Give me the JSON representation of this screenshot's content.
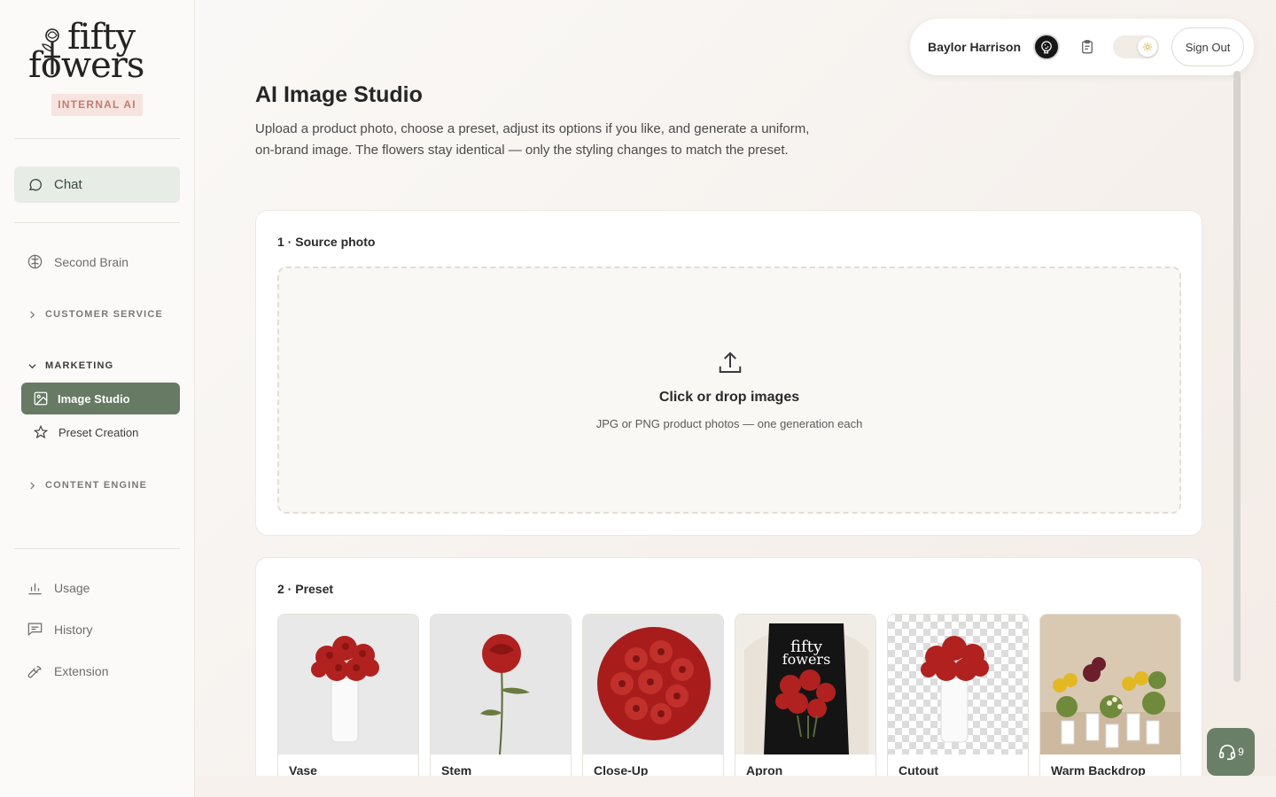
{
  "brand": {
    "logo_line1": "fifty",
    "logo_line2": "fowers",
    "badge": "INTERNAL AI"
  },
  "sidebar": {
    "chat_label": "Chat",
    "second_brain": "Second Brain",
    "sections": [
      {
        "label": "CUSTOMER SERVICE",
        "expanded": false
      },
      {
        "label": "MARKETING",
        "expanded": true
      },
      {
        "label": "CONTENT ENGINE",
        "expanded": false
      }
    ],
    "marketing_items": [
      {
        "label": "Image Studio",
        "active": true,
        "icon": "image-icon"
      },
      {
        "label": "Preset Creation",
        "active": false,
        "icon": "star-icon"
      }
    ],
    "bottom_items": [
      {
        "label": "Usage",
        "icon": "bar-chart-icon"
      },
      {
        "label": "History",
        "icon": "message-square-icon"
      },
      {
        "label": "Extension",
        "icon": "wrench-icon"
      }
    ]
  },
  "header": {
    "user_name": "Baylor Harrison",
    "sign_out": "Sign Out"
  },
  "main": {
    "title": "AI Image Studio",
    "description": "Upload a product photo, choose a preset, adjust its options if you like, and generate a uniform, on-brand image. The flowers stay identical — only the styling changes to match the preset.",
    "source_section": {
      "title": "1 · Source photo",
      "drop_title": "Click or drop images",
      "drop_subtitle": "JPG or PNG product photos — one generation each"
    },
    "preset_section": {
      "title": "2 · Preset",
      "presets": [
        "Vase",
        "Stem",
        "Close-Up",
        "Apron",
        "Cutout",
        "Warm Backdrop"
      ]
    }
  },
  "support_badge": "9",
  "colors": {
    "accent": "#667a64",
    "badge_bg": "#f7e4df",
    "badge_text": "#c07e73"
  }
}
